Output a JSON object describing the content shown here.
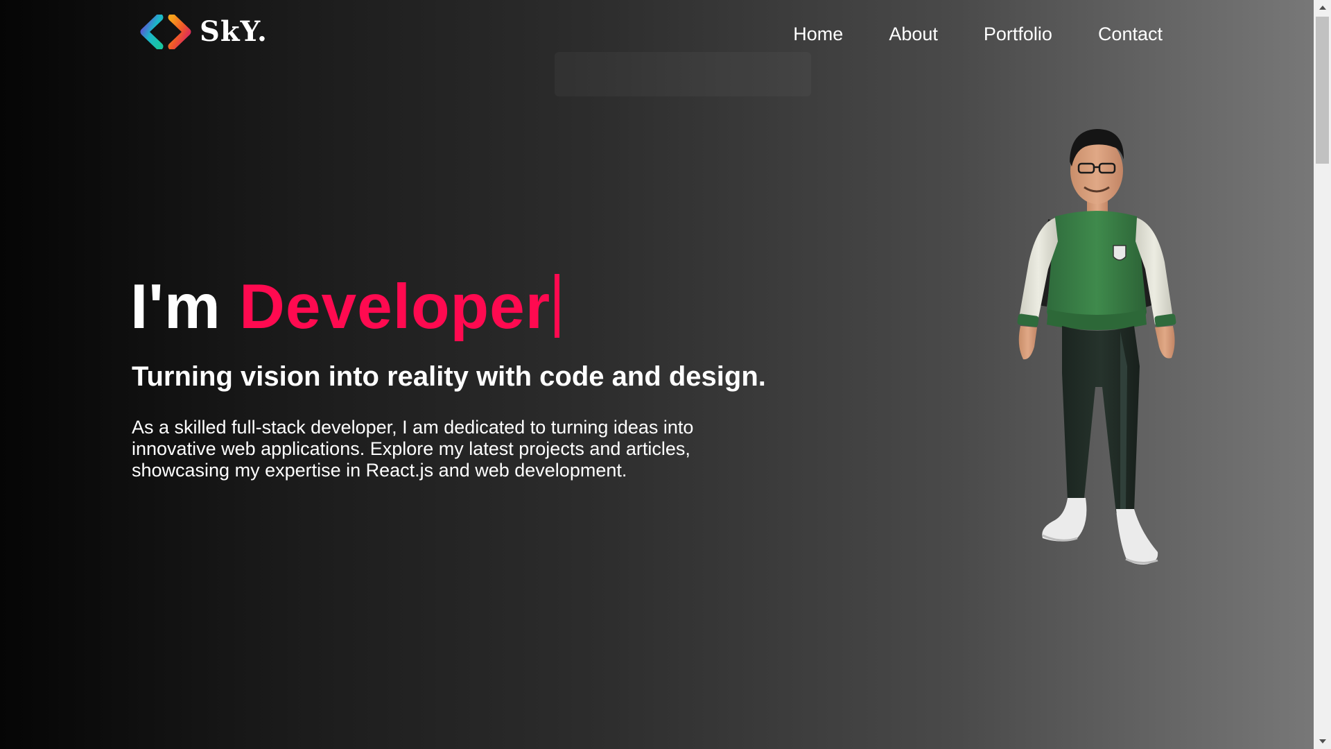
{
  "header": {
    "brand": "SkY.",
    "nav": [
      "Home",
      "About",
      "Portfolio",
      "Contact"
    ]
  },
  "hero": {
    "title_prefix": "I'm",
    "title_accent": "Developer",
    "subtitle": "Turning vision into reality with code and design.",
    "description": "As a skilled full-stack developer, I am dedicated to turning ideas into innovative web applications. Explore my latest projects and articles, showcasing my expertise in React.js and web development."
  },
  "colors": {
    "accent": "#ff0a50",
    "logo_left": "#1bb7c9",
    "logo_right": "#f05a28"
  },
  "icons": {
    "logo": "code-brackets-icon",
    "avatar": "3d-developer-avatar"
  }
}
